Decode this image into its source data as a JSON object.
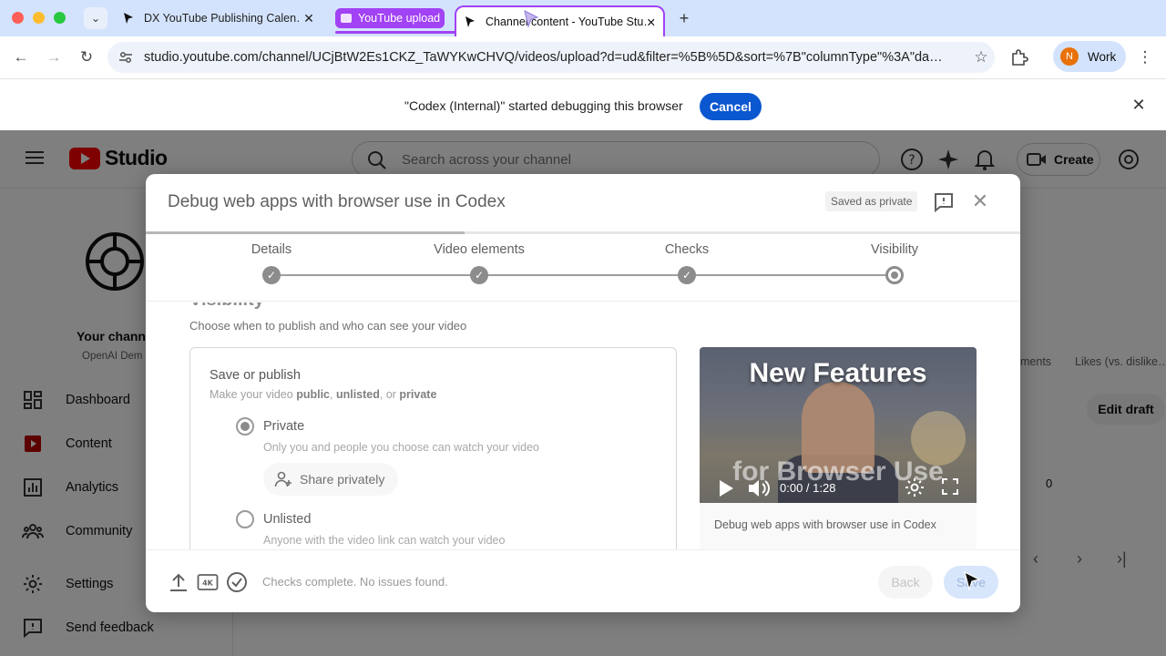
{
  "browser": {
    "tabs": [
      {
        "title": "DX YouTube Publishing Calen…"
      },
      {
        "title": "Channel content - YouTube Stu…"
      }
    ],
    "tab_group": {
      "label": "YouTube upload",
      "color": "#a142f4"
    },
    "url": "studio.youtube.com/channel/UCjBtW2Es1CKZ_TaWYKwCHVQ/videos/upload?d=ud&filter=%5B%5D&sort=%7B\"columnType\"%3A\"da…",
    "profile": {
      "initial": "N",
      "label": "Work"
    },
    "infobar": {
      "message": "\"Codex (Internal)\" started debugging this browser",
      "cancel_label": "Cancel"
    }
  },
  "studio": {
    "logo_text": "Studio",
    "search_placeholder": "Search across your channel",
    "create_label": "Create",
    "channel": {
      "name": "Your chann",
      "subtitle": "OpenAI Dem"
    },
    "nav": [
      {
        "label": "Dashboard",
        "icon": "dashboard-icon"
      },
      {
        "label": "Content",
        "icon": "content-icon"
      },
      {
        "label": "Analytics",
        "icon": "analytics-icon"
      },
      {
        "label": "Community",
        "icon": "community-icon"
      },
      {
        "label": "Settings",
        "icon": "settings-icon"
      },
      {
        "label": "Send feedback",
        "icon": "feedback-icon"
      }
    ],
    "table": {
      "col_comments": "ments",
      "col_likes": "Likes (vs. dislike…",
      "edit_draft": "Edit draft",
      "value": "0"
    }
  },
  "dialog": {
    "title": "Debug web apps with browser use in Codex",
    "saved_badge": "Saved as private",
    "progress_fraction": 0.365,
    "steps": [
      {
        "label": "Details",
        "state": "done"
      },
      {
        "label": "Video elements",
        "state": "done"
      },
      {
        "label": "Checks",
        "state": "done"
      },
      {
        "label": "Visibility",
        "state": "current"
      }
    ],
    "visibility": {
      "heading": "Visibility",
      "subtitle": "Choose when to publish and who can see your video",
      "card_title": "Save or publish",
      "card_sub_prefix": "Make your video ",
      "card_sub_public": "public",
      "card_sub_sep1": ", ",
      "card_sub_unlisted": "unlisted",
      "card_sub_sep2": ", or ",
      "card_sub_private": "private",
      "options": [
        {
          "label": "Private",
          "desc": "Only you and people you choose can watch your video",
          "checked": true
        },
        {
          "label": "Unlisted",
          "desc": "Anyone with the video link can watch your video",
          "checked": false
        }
      ],
      "share_label": "Share privately"
    },
    "preview": {
      "overlay_line1": "New Features",
      "overlay_line2": "for Browser Use",
      "time": "0:00 / 1:28",
      "caption": "Debug web apps with browser use in Codex"
    },
    "footer": {
      "status": "Checks complete. No issues found.",
      "hd_badge": "4K",
      "back_label": "Back",
      "save_label": "Save"
    }
  }
}
